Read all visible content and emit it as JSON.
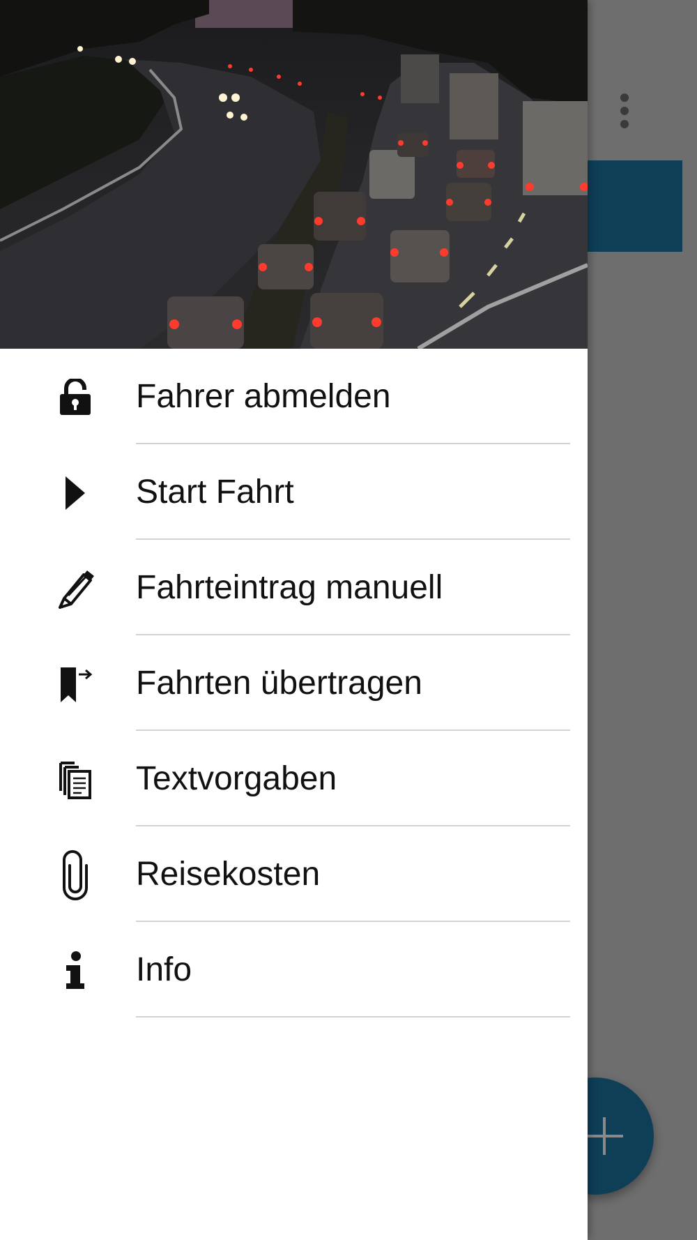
{
  "drawer": {
    "header_image": "night-highway-traffic-photo",
    "items": [
      {
        "label": "Fahrer abmelden",
        "icon": "unlock-icon"
      },
      {
        "label": "Start Fahrt",
        "icon": "play-icon"
      },
      {
        "label": "Fahrteintrag manuell",
        "icon": "pencil-icon"
      },
      {
        "label": "Fahrten übertragen",
        "icon": "bookmark-export-icon"
      },
      {
        "label": "Textvorgaben",
        "icon": "documents-icon"
      },
      {
        "label": "Reisekosten",
        "icon": "paperclip-icon"
      },
      {
        "label": "Info",
        "icon": "info-icon"
      }
    ]
  },
  "background": {
    "overflow_icon": "more-vert-icon",
    "fab_icon": "plus-icon",
    "accent_color": "#0e3f57"
  }
}
